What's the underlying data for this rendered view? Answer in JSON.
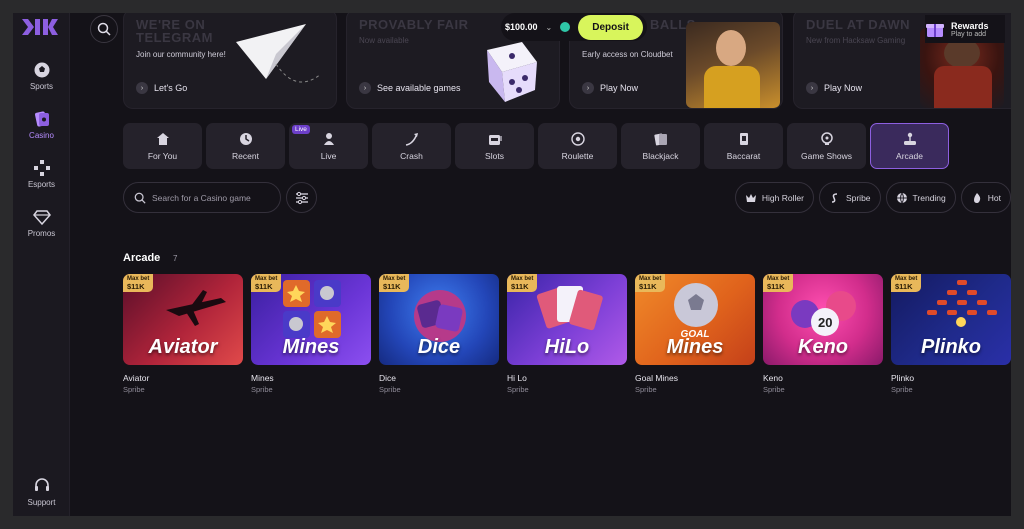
{
  "sidebar": {
    "items": [
      {
        "label": "Sports",
        "icon": "soccer-ball-icon"
      },
      {
        "label": "Casino",
        "icon": "casino-chip-icon",
        "active": true
      },
      {
        "label": "Esports",
        "icon": "gamepad-icon"
      },
      {
        "label": "Promos",
        "icon": "diamond-icon"
      }
    ],
    "support": "Support"
  },
  "promos": [
    {
      "ghost_title": "WE'RE ON TELEGRAM",
      "subtitle": "Join our community here!",
      "cta": "Let's Go"
    },
    {
      "ghost_title": "PROVABLY FAIR",
      "subtitle": "Now available",
      "cta": "See available games"
    },
    {
      "ghost_title": "BALLS",
      "subtitle": "Early access on Cloudbet",
      "cta": "Play Now"
    },
    {
      "ghost_title": "DUEL AT DAWN",
      "subtitle": "New from Hacksaw Gaming",
      "cta": "Play Now"
    }
  ],
  "header": {
    "balance": "$100.00",
    "deposit": "Deposit",
    "rewards_title": "Rewards",
    "rewards_sub": "Play to add"
  },
  "categories": [
    {
      "label": "For You"
    },
    {
      "label": "Recent"
    },
    {
      "label": "Live",
      "badge": "Live"
    },
    {
      "label": "Crash"
    },
    {
      "label": "Slots"
    },
    {
      "label": "Roulette"
    },
    {
      "label": "Blackjack"
    },
    {
      "label": "Baccarat"
    },
    {
      "label": "Game Shows"
    },
    {
      "label": "Arcade",
      "active": true
    }
  ],
  "search": {
    "placeholder": "Search for a Casino game"
  },
  "tags": [
    {
      "label": "High Roller",
      "icon": "crown-icon"
    },
    {
      "label": "Spribe",
      "icon": "spribe-icon"
    },
    {
      "label": "Trending",
      "icon": "globe-icon"
    },
    {
      "label": "Hot",
      "icon": "flame-icon"
    }
  ],
  "section": {
    "title": "Arcade",
    "count": "7"
  },
  "games": [
    {
      "title": "Aviator",
      "name": "Aviator",
      "provider": "Spribe",
      "maxbet_label": "Max bet",
      "maxbet": "$11K",
      "bg": "#b0243a"
    },
    {
      "title": "Mines",
      "name": "Mines",
      "provider": "Spribe",
      "maxbet_label": "Max bet",
      "maxbet": "$11K",
      "bg": "#5a2fc4"
    },
    {
      "title": "Dice",
      "name": "Dice",
      "provider": "Spribe",
      "maxbet_label": "Max bet",
      "maxbet": "$11K",
      "bg": "#2a5fd6"
    },
    {
      "title": "HiLo",
      "name": "Hi Lo",
      "provider": "Spribe",
      "maxbet_label": "Max bet",
      "maxbet": "$11K",
      "bg": "#7c3fd6"
    },
    {
      "title": "Mines",
      "title_top": "GOAL",
      "name": "Goal Mines",
      "provider": "Spribe",
      "maxbet_label": "Max bet",
      "maxbet": "$11K",
      "bg": "#e0631c"
    },
    {
      "title": "Keno",
      "name": "Keno",
      "provider": "Spribe",
      "maxbet_label": "Max bet",
      "maxbet": "$11K",
      "bg": "#d22d8c"
    },
    {
      "title": "Plinko",
      "name": "Plinko",
      "provider": "Spribe",
      "maxbet_label": "Max bet",
      "maxbet": "$11K",
      "bg": "#1f2a8a"
    }
  ],
  "colors": {
    "accent": "#8d5fe0",
    "deposit": "#d8f55c",
    "background": "#141218"
  }
}
